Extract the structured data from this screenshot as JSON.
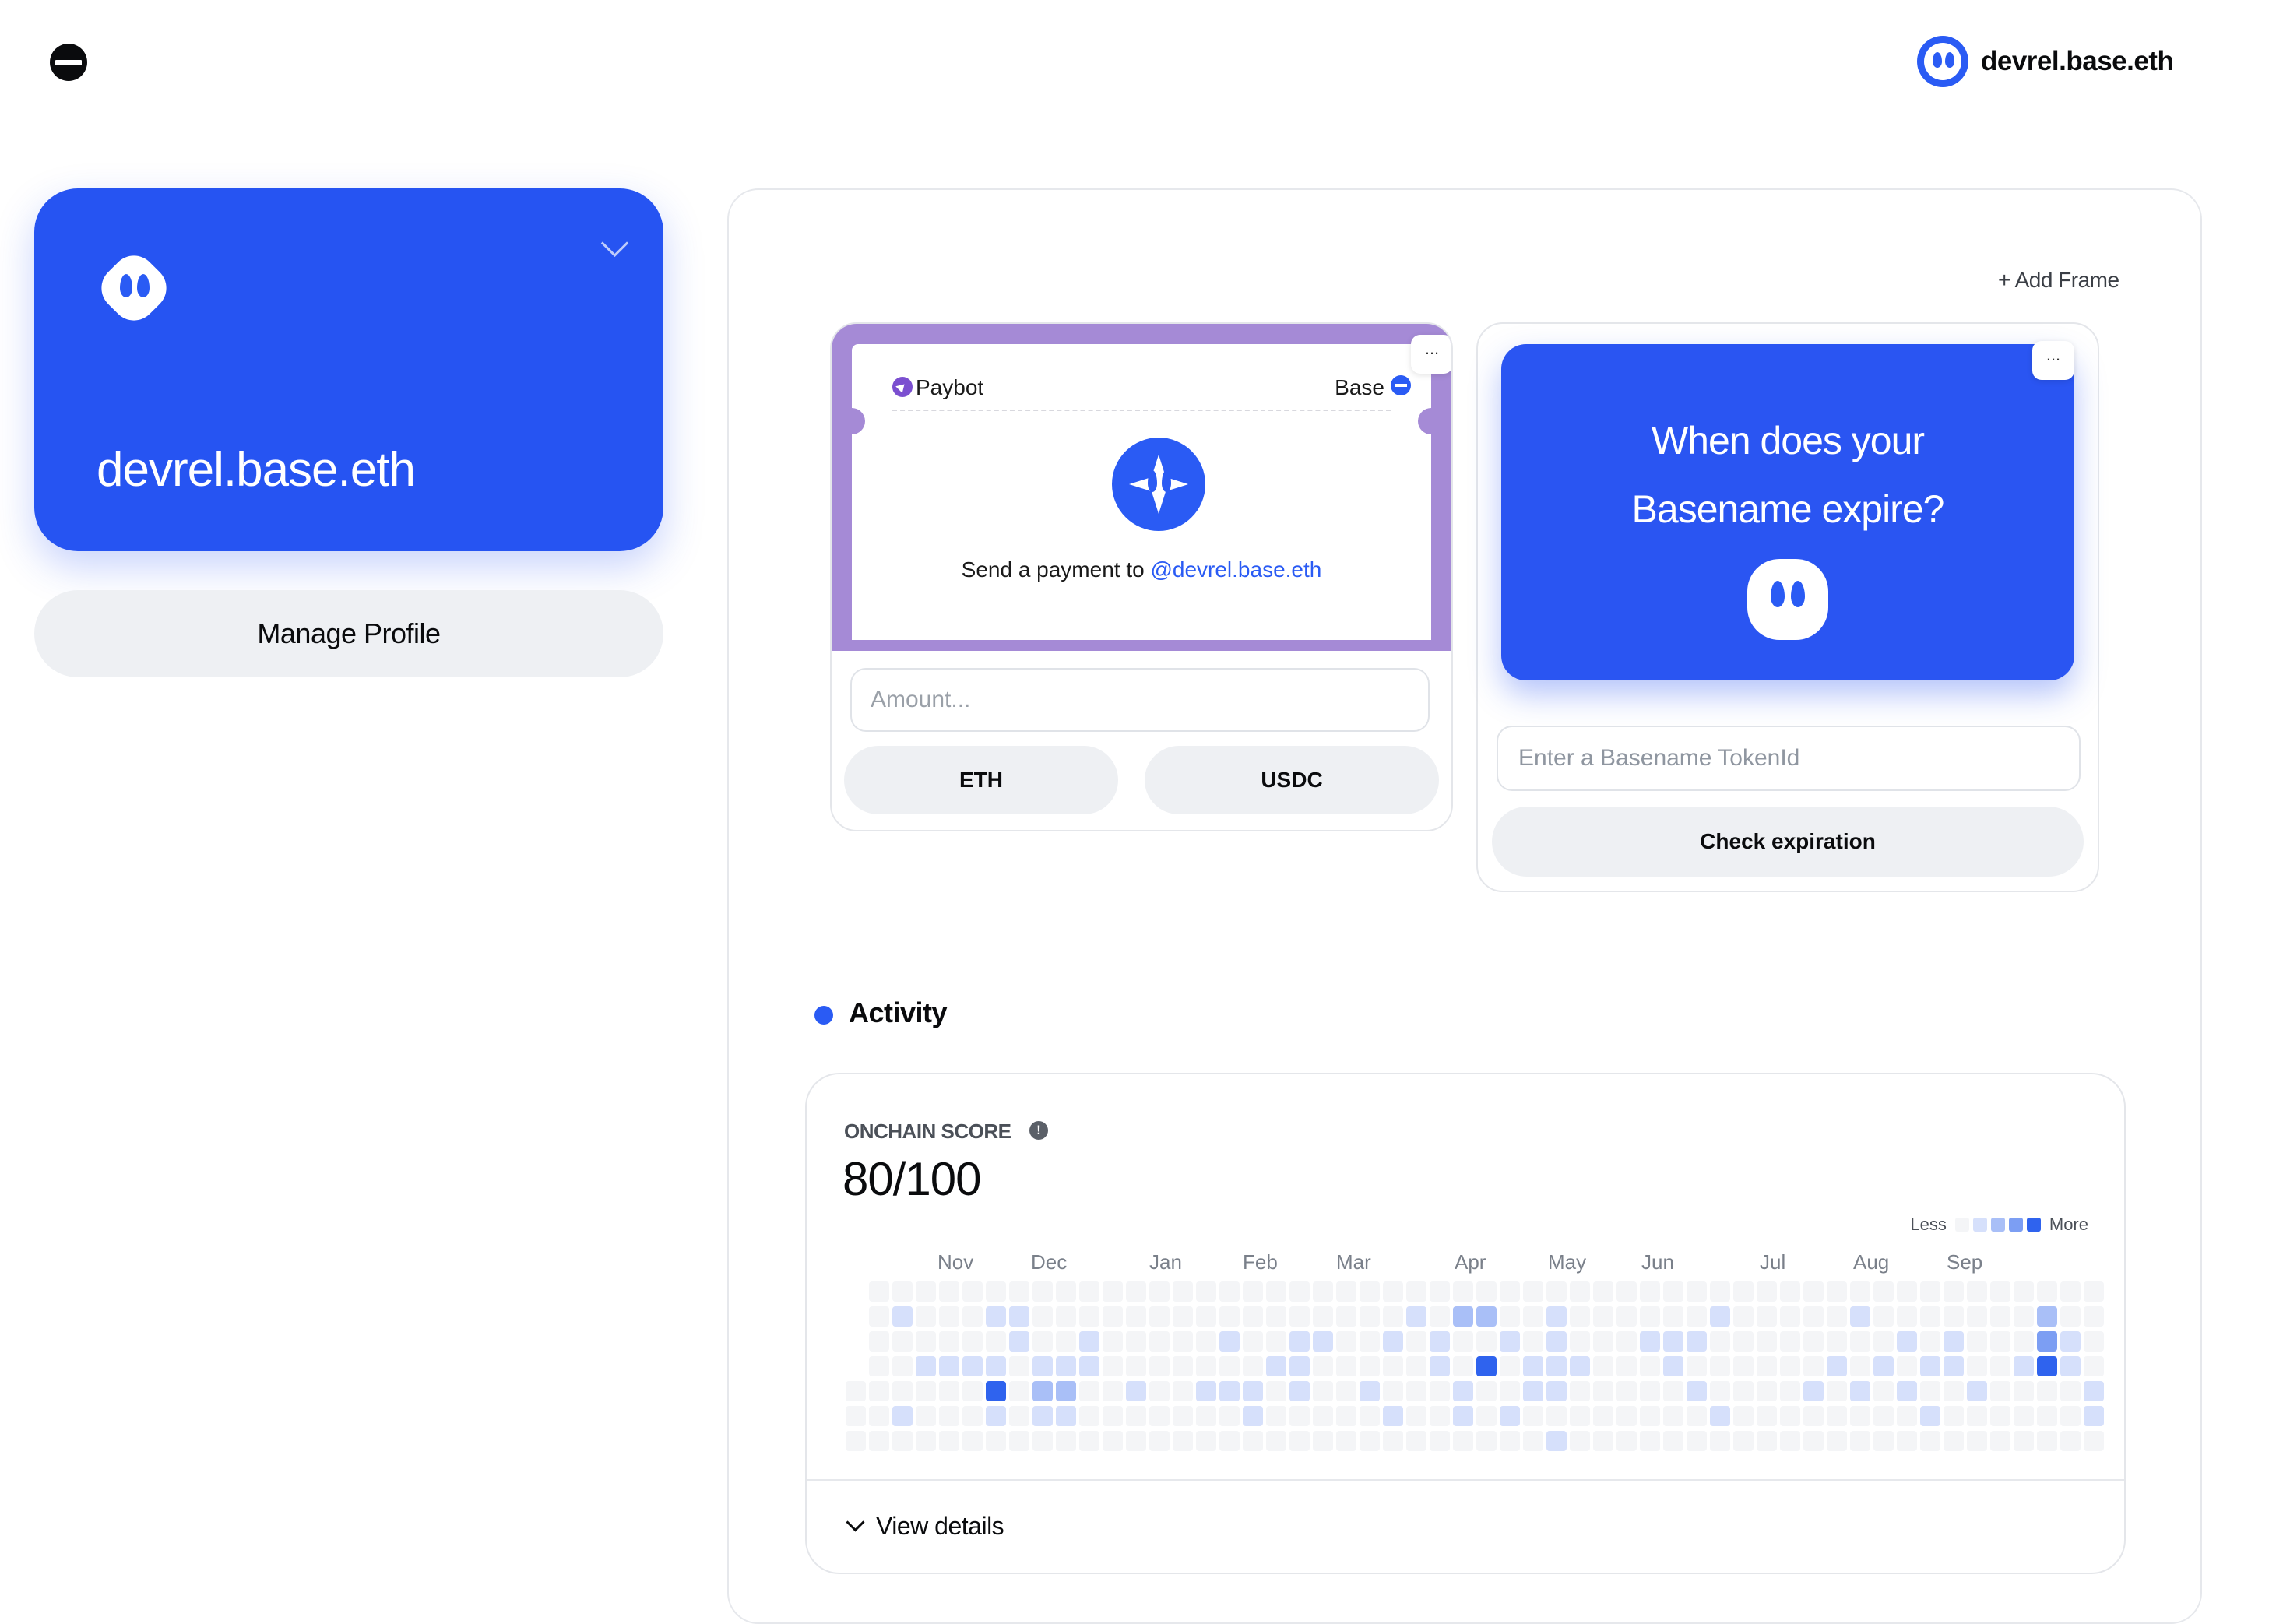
{
  "header": {
    "logo_icon": "base-logo-icon",
    "profile_name": "devrel.base.eth"
  },
  "sidebar": {
    "card_name": "devrel.base.eth",
    "card_color": "#2654f2",
    "manage_label": "Manage Profile"
  },
  "frames": {
    "add_frame_label": "+ Add Frame",
    "paybot": {
      "title": "Paybot",
      "network": "Base",
      "menu": "...",
      "send_prefix": "Send a payment to ",
      "send_handle": "@devrel.base.eth",
      "amount_placeholder": "Amount...",
      "eth_label": "ETH",
      "usdc_label": "USDC"
    },
    "basename": {
      "question_line1": "When does your",
      "question_line2": "Basename expire?",
      "menu": "...",
      "input_placeholder": "Enter a Basename TokenId",
      "check_label": "Check expiration"
    }
  },
  "activity": {
    "title": "Activity",
    "score_label": "ONCHAIN SCORE",
    "info": "!",
    "score_value": "80/100",
    "legend_less": "Less",
    "legend_more": "More",
    "months": [
      "Nov",
      "Dec",
      "Jan",
      "Feb",
      "Mar",
      "Apr",
      "May",
      "Jun",
      "Jul",
      "Aug",
      "Sep"
    ],
    "view_details": "View details",
    "colors": [
      "#f4f5f7",
      "#d6e0fb",
      "#a9bff7",
      "#7c9ef3",
      "#2f63ee"
    ],
    "active_cells": [
      [
        2,
        1,
        1
      ],
      [
        6,
        1,
        1
      ],
      [
        7,
        1,
        1
      ],
      [
        24,
        1,
        1
      ],
      [
        26,
        1,
        2
      ],
      [
        27,
        1,
        2
      ],
      [
        30,
        1,
        1
      ],
      [
        37,
        1,
        1
      ],
      [
        43,
        1,
        1
      ],
      [
        51,
        1,
        2
      ],
      [
        7,
        2,
        1
      ],
      [
        10,
        2,
        1
      ],
      [
        16,
        2,
        1
      ],
      [
        19,
        2,
        1
      ],
      [
        20,
        2,
        1
      ],
      [
        23,
        2,
        1
      ],
      [
        25,
        2,
        1
      ],
      [
        28,
        2,
        1
      ],
      [
        30,
        2,
        1
      ],
      [
        34,
        2,
        1
      ],
      [
        35,
        2,
        1
      ],
      [
        36,
        2,
        1
      ],
      [
        45,
        2,
        1
      ],
      [
        47,
        2,
        1
      ],
      [
        51,
        2,
        3
      ],
      [
        52,
        2,
        1
      ],
      [
        3,
        3,
        1
      ],
      [
        4,
        3,
        1
      ],
      [
        5,
        3,
        1
      ],
      [
        6,
        3,
        1
      ],
      [
        8,
        3,
        1
      ],
      [
        9,
        3,
        1
      ],
      [
        10,
        3,
        1
      ],
      [
        18,
        3,
        1
      ],
      [
        19,
        3,
        1
      ],
      [
        25,
        3,
        1
      ],
      [
        27,
        3,
        4
      ],
      [
        29,
        3,
        1
      ],
      [
        30,
        3,
        1
      ],
      [
        31,
        3,
        1
      ],
      [
        35,
        3,
        1
      ],
      [
        42,
        3,
        1
      ],
      [
        44,
        3,
        1
      ],
      [
        46,
        3,
        1
      ],
      [
        47,
        3,
        1
      ],
      [
        50,
        3,
        1
      ],
      [
        51,
        3,
        4
      ],
      [
        52,
        3,
        1
      ],
      [
        6,
        4,
        4
      ],
      [
        8,
        4,
        2
      ],
      [
        9,
        4,
        2
      ],
      [
        12,
        4,
        1
      ],
      [
        15,
        4,
        1
      ],
      [
        16,
        4,
        1
      ],
      [
        17,
        4,
        1
      ],
      [
        19,
        4,
        1
      ],
      [
        22,
        4,
        1
      ],
      [
        26,
        4,
        1
      ],
      [
        29,
        4,
        1
      ],
      [
        30,
        4,
        1
      ],
      [
        36,
        4,
        1
      ],
      [
        41,
        4,
        1
      ],
      [
        43,
        4,
        1
      ],
      [
        45,
        4,
        1
      ],
      [
        48,
        4,
        1
      ],
      [
        53,
        4,
        1
      ],
      [
        2,
        5,
        1
      ],
      [
        6,
        5,
        1
      ],
      [
        8,
        5,
        1
      ],
      [
        9,
        5,
        1
      ],
      [
        17,
        5,
        1
      ],
      [
        23,
        5,
        1
      ],
      [
        26,
        5,
        1
      ],
      [
        28,
        5,
        1
      ],
      [
        37,
        5,
        1
      ],
      [
        46,
        5,
        1
      ],
      [
        53,
        5,
        1
      ],
      [
        30,
        6,
        1
      ]
    ]
  }
}
